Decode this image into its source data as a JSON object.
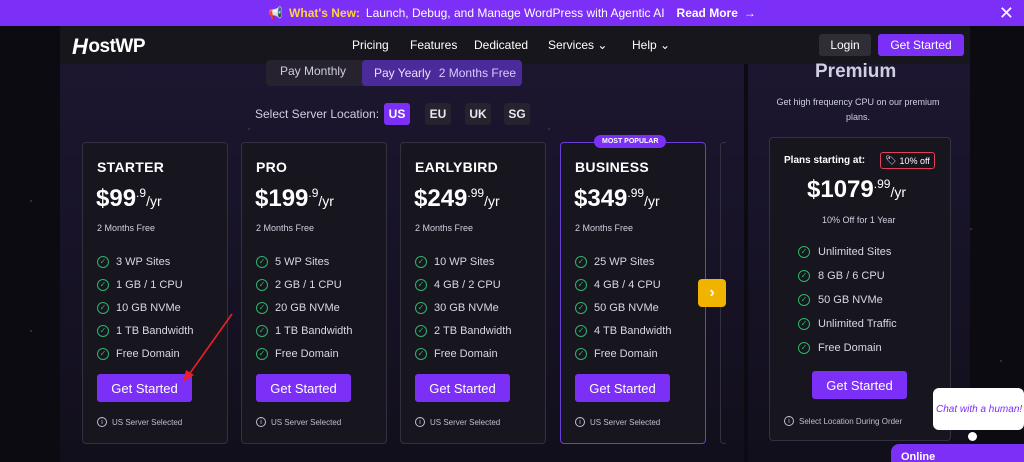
{
  "announcement": {
    "megaphone": "📢",
    "highlight": "What's New:",
    "text": "Launch, Debug, and Manage WordPress with Agentic AI",
    "link": "Read More",
    "arrow": "→",
    "close": "✕"
  },
  "nav": {
    "logo_h": "H",
    "logo_rest": "ostWP",
    "items": [
      "Pricing",
      "Features",
      "Dedicated",
      "Services",
      "Help"
    ],
    "chevron": "⌄",
    "login": "Login",
    "get_started": "Get Started"
  },
  "billing_toggle": {
    "monthly": "Pay Monthly",
    "yearly": "Pay Yearly",
    "yearly_note": "2 Months Free"
  },
  "location": {
    "label": "Select Server Location:",
    "options": [
      "US",
      "EU",
      "UK",
      "SG"
    ],
    "selected": "US"
  },
  "plans": [
    {
      "name": "STARTER",
      "price": "$99",
      "decimal": ".9",
      "per": "/yr",
      "note": "2 Months Free",
      "features": [
        "3 WP Sites",
        "1 GB / 1 CPU",
        "10 GB NVMe",
        "1 TB Bandwidth",
        "Free Domain"
      ],
      "cta": "Get Started",
      "server": "US Server Selected"
    },
    {
      "name": "PRO",
      "price": "$199",
      "decimal": ".9",
      "per": "/yr",
      "note": "2 Months Free",
      "features": [
        "5 WP Sites",
        "2 GB / 1 CPU",
        "20 GB NVMe",
        "1 TB Bandwidth",
        "Free Domain"
      ],
      "cta": "Get Started",
      "server": "US Server Selected"
    },
    {
      "name": "EARLYBIRD",
      "price": "$249",
      "decimal": ".99",
      "per": "/yr",
      "note": "2 Months Free",
      "features": [
        "10 WP Sites",
        "4 GB / 2 CPU",
        "30 GB NVMe",
        "2 TB Bandwidth",
        "Free Domain"
      ],
      "cta": "Get Started",
      "server": "US Server Selected"
    },
    {
      "name": "BUSINESS",
      "price": "$349",
      "decimal": ".99",
      "per": "/yr",
      "badge": "MOST POPULAR",
      "note": "2 Months Free",
      "features": [
        "25 WP Sites",
        "4 GB / 4 CPU",
        "50 GB NVMe",
        "4 TB Bandwidth",
        "Free Domain"
      ],
      "cta": "Get Started",
      "server": "US Server Selected"
    }
  ],
  "premium": {
    "title": "Premium",
    "description": "Get high frequency CPU on our premium plans.",
    "starting": "Plans starting at:",
    "discount": "10% off",
    "price": "$1079",
    "decimal": ".99",
    "per": "/yr",
    "off_note": "10% Off for 1 Year",
    "features": [
      "Unlimited Sites",
      "8 GB / 6 CPU",
      "50 GB NVMe",
      "Unlimited Traffic",
      "Free Domain"
    ],
    "cta": "Get Started",
    "note": "Select Location During Order"
  },
  "icons": {
    "check": "✓",
    "info": "i",
    "tag": "🏷",
    "next": "›"
  },
  "chat": {
    "bubble": "Chat with a human!",
    "status": "Online"
  },
  "colors": {
    "accent": "#7b2ff7",
    "check": "#2fb36b",
    "highlight": "#ffd23f",
    "next_button": "#f0b400"
  }
}
